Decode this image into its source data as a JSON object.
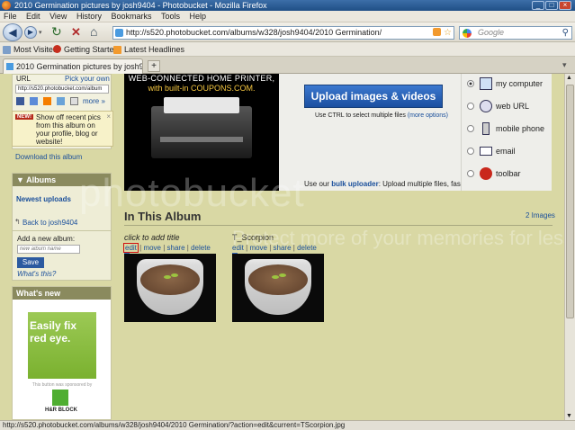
{
  "window": {
    "title": "2010 Germination pictures by josh9404 - Photobucket - Mozilla Firefox"
  },
  "menu": [
    "File",
    "Edit",
    "View",
    "History",
    "Bookmarks",
    "Tools",
    "Help"
  ],
  "nav": {
    "url": "http://s520.photobucket.com/albums/w328/josh9404/2010 Germination/",
    "search_placeholder": "Google"
  },
  "bookmarks": [
    "Most Visited",
    "Getting Started",
    "Latest Headlines"
  ],
  "tab": {
    "title": "2010 Germination pictures by josh94..."
  },
  "sidebar": {
    "url_label": "URL",
    "pick_own": "Pick your own",
    "url_value": "http://s520.photobucket.com/album",
    "more": "more »",
    "new_badge": "NEW!",
    "tip": "Show off recent pics from this album on your profile, blog or website!",
    "download": "Download this album",
    "albums_title": "Albums",
    "newest": "Newest uploads",
    "back_to": "Back to josh9404",
    "add_album_label": "Add a new album:",
    "album_placeholder": "new album name",
    "save": "Save",
    "whats_this": "What's this?",
    "whats_new": "What's new",
    "easily_fix": "Easily fix red eye.",
    "sponsor": "This button was sponsored by",
    "hr_block": "H&R BLOCK"
  },
  "ad": {
    "line1": "WEB-CONNECTED HOME PRINTER,",
    "line2": "with built-in COUPONS.COM."
  },
  "upload": {
    "button": "Upload images & videos",
    "ctrl_hint": "Use CTRL to select multiple files",
    "more_options": "(more options)",
    "bulk_pre": "Use our",
    "bulk_link": "bulk uploader",
    "bulk_post": ": Upload multiple files, fast!"
  },
  "share": [
    "my computer",
    "web URL",
    "mobile phone",
    "email",
    "toolbar"
  ],
  "album": {
    "heading": "In This Album",
    "count": "2 Images",
    "items": [
      {
        "title": "click to add title",
        "title_italic": true
      },
      {
        "title": "T_Scorpion",
        "title_italic": false
      }
    ],
    "actions": [
      "edit",
      "move",
      "share",
      "delete"
    ]
  },
  "watermark": {
    "big": "photobucket",
    "small": "Protect more of your memories for less!"
  },
  "status": "http://s520.photobucket.com/albums/w328/josh9404/2010 Germination/?action=edit&current=TScorpion.jpg"
}
